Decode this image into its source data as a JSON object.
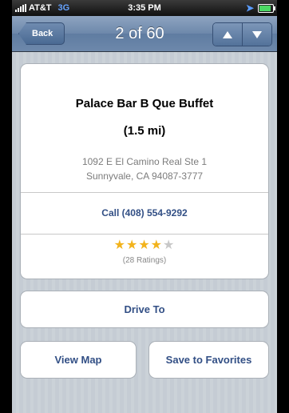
{
  "status_bar": {
    "carrier": "AT&T",
    "network": "3G",
    "time": "3:35 PM"
  },
  "nav": {
    "back_label": "Back",
    "title": "2 of 60",
    "prev_icon": "triangle-up-icon",
    "next_icon": "triangle-down-icon"
  },
  "listing": {
    "name": "Palace Bar B Que Buffet",
    "distance": "(1.5 mi)",
    "address_line1": "1092 E El Camino Real Ste 1",
    "address_line2": "Sunnyvale, CA 94087-3777",
    "call_label": "Call (408) 554-9292",
    "rating": 4,
    "rating_max": 5,
    "ratings_count_label": "(28 Ratings)"
  },
  "actions": {
    "drive_to": "Drive To",
    "view_map": "View Map",
    "save_favorites": "Save to Favorites"
  },
  "colors": {
    "nav_bar": "#6d88ab",
    "link_text": "#324f85",
    "star_on": "#f2b31c",
    "star_off": "#c8c8c8",
    "background": "#c5ccd4"
  }
}
